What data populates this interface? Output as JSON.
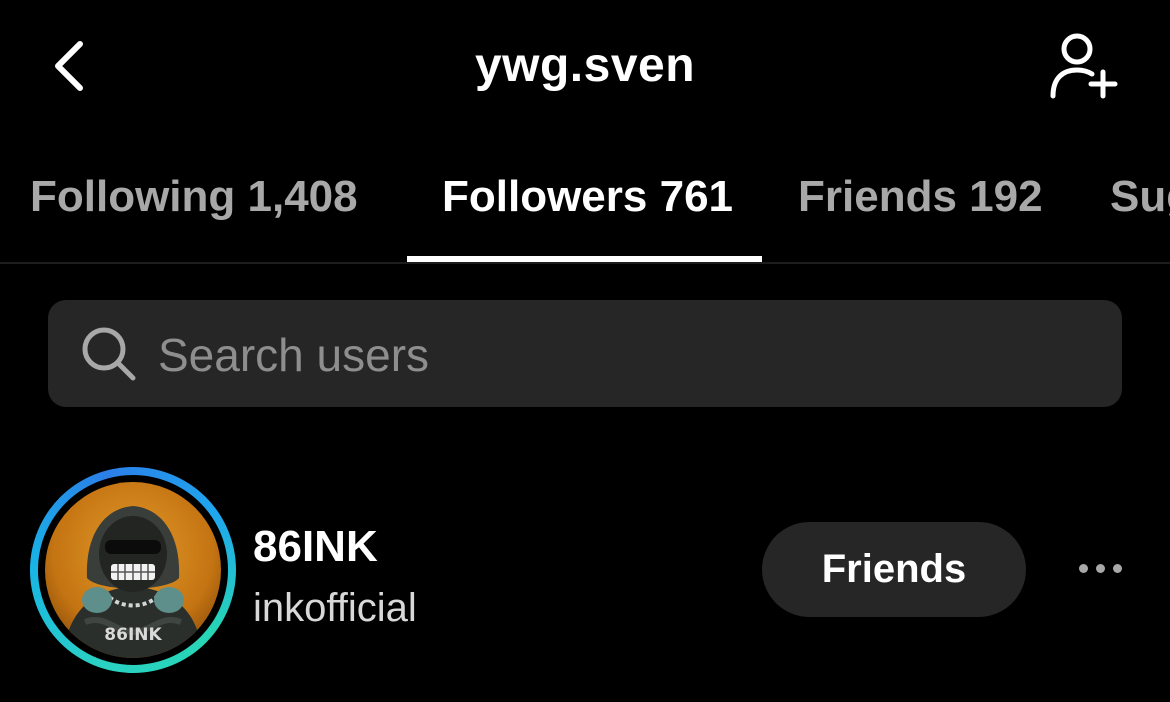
{
  "header": {
    "title": "ywg.sven",
    "back_icon": "chevron-left-icon",
    "add_user_icon": "add-user-icon"
  },
  "tabs": [
    {
      "label": "Following 1,408",
      "active": false
    },
    {
      "label": "Followers 761",
      "active": true
    },
    {
      "label": "Friends 192",
      "active": false
    },
    {
      "label": "Suggested",
      "active": false
    }
  ],
  "search": {
    "placeholder": "Search users",
    "icon": "search-icon"
  },
  "users": [
    {
      "display_name": "86INK",
      "username": "inkofficial",
      "avatar_text": "86INK",
      "action_label": "Friends",
      "more_icon": "more-icon"
    }
  ],
  "colors": {
    "background": "#000000",
    "surface": "#262626",
    "muted_text": "#a8a8a8",
    "story_ring_start": "#2ad1c3",
    "story_ring_end": "#2b7fe8"
  }
}
